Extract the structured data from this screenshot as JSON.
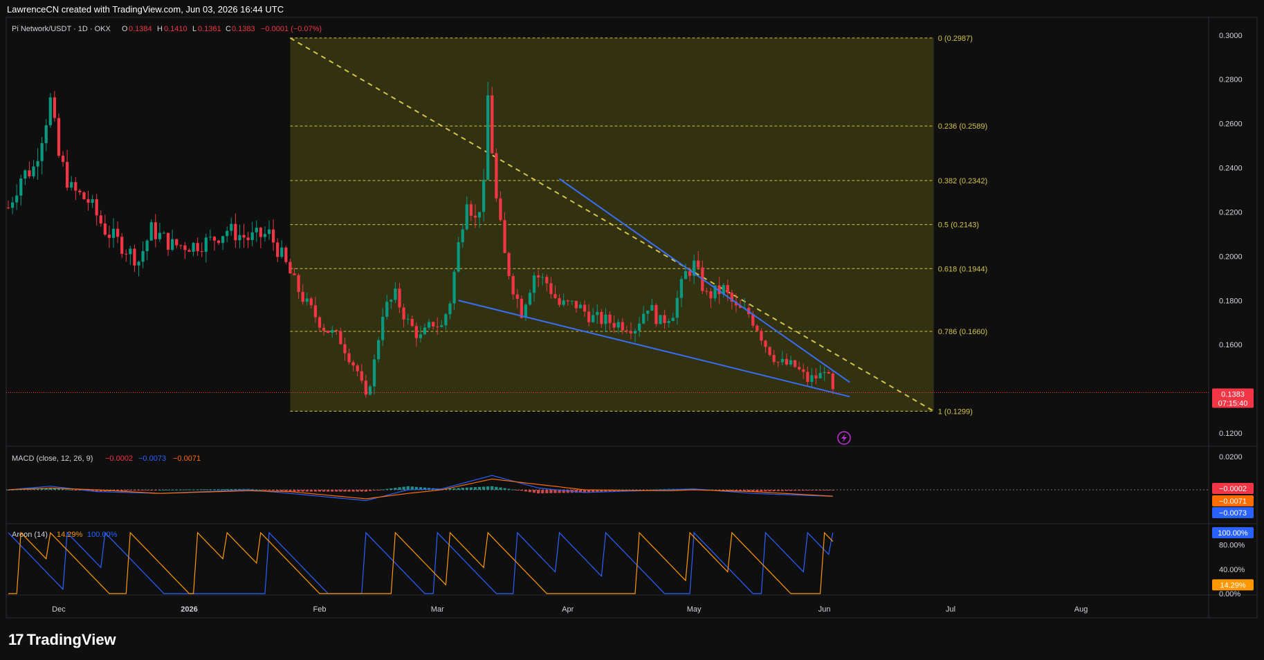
{
  "header": {
    "caption": "LawrenceCN created with TradingView.com, Jun 03, 2026 16:44 UTC"
  },
  "symbol_bar": {
    "symbol": "Pi Network/USDT · 1D · OKX",
    "o_label": "O",
    "o_value": "0.1384",
    "h_label": "H",
    "h_value": "0.1410",
    "l_label": "L",
    "l_value": "0.1361",
    "c_label": "C",
    "c_value": "0.1383",
    "change": "−0.0001 (−0.07%)"
  },
  "brand": {
    "name": "TradingView",
    "logo": "17"
  },
  "colors": {
    "bg": "#0f0f0f",
    "pane_border": "#2a2e39",
    "up": "#089981",
    "down": "#f23645",
    "fib_zone": "#3b3a12",
    "fib_line": "#d4c44a",
    "trendline": "#3a6ff2",
    "macd_line": "#2962ff",
    "signal_line": "#ff6d00",
    "hist_pos": "#26a69a",
    "hist_neg": "#ef5350",
    "aroon_up": "#ff9800",
    "aroon_down": "#2962ff",
    "price_label": "#f23645"
  },
  "indicators": {
    "macd": {
      "title": "MACD (close, 12, 26, 9)",
      "v1": "−0.0002",
      "v2": "−0.0073",
      "v3": "−0.0071",
      "axis": [
        "0.0200"
      ],
      "labels": [
        "−0.0002",
        "−0.0071",
        "−0.0073"
      ]
    },
    "aroon": {
      "title": "Aroon (14)",
      "v1": "14.29%",
      "v2": "100.00%",
      "axis": [
        "80.00%",
        "40.00%",
        "0.00%"
      ],
      "labels": [
        "100.00%",
        "14.29%"
      ]
    }
  },
  "last_price": {
    "value": "0.1383",
    "countdown": "07:15:40"
  },
  "chart_data": {
    "type": "candlestick",
    "title": "Pi Network/USDT · 1D · OKX",
    "ylim": [
      0.115,
      0.3065
    ],
    "y_ticks": [
      0.3,
      0.28,
      0.26,
      0.24,
      0.22,
      0.2,
      0.18,
      0.16,
      0.12
    ],
    "y_tick_labels": [
      "0.3000",
      "0.2800",
      "0.2600",
      "0.2400",
      "0.2200",
      "0.2000",
      "0.1800",
      "0.1600",
      "0.1200"
    ],
    "x_tick_labels": [
      "Dec",
      "2026",
      "Feb",
      "Mar",
      "Apr",
      "May",
      "Jun",
      "Jul",
      "Aug"
    ],
    "x_tick_dates": [
      "2025-12-01",
      "2026-01-01",
      "2026-02-01",
      "2026-03-01",
      "2026-04-01",
      "2026-05-01",
      "2026-06-01",
      "2026-07-01",
      "2026-08-01"
    ],
    "date_range": [
      "2025-11-19",
      "2026-08-31"
    ],
    "fib_levels": [
      {
        "ratio": "0",
        "price": 0.2987,
        "label": "0 (0.2987)"
      },
      {
        "ratio": "0.236",
        "price": 0.2589,
        "label": "0.236 (0.2589)"
      },
      {
        "ratio": "0.382",
        "price": 0.2342,
        "label": "0.382 (0.2342)"
      },
      {
        "ratio": "0.5",
        "price": 0.2143,
        "label": "0.5 (0.2143)"
      },
      {
        "ratio": "0.618",
        "price": 0.1944,
        "label": "0.618 (0.1944)"
      },
      {
        "ratio": "0.786",
        "price": 0.166,
        "label": "0.786 (0.1660)"
      },
      {
        "ratio": "1",
        "price": 0.1299,
        "label": "1 (0.1299)"
      }
    ],
    "fib_date_range": [
      "2026-01-25",
      "2026-06-27"
    ],
    "fib_diagonal": {
      "from": [
        "2026-01-25",
        0.2987
      ],
      "to": [
        "2026-06-27",
        0.1299
      ]
    },
    "wedge_upper": {
      "from": [
        "2026-03-30",
        0.235
      ],
      "to": [
        "2026-06-07",
        0.143
      ]
    },
    "wedge_lower": {
      "from": [
        "2026-03-06",
        0.18
      ],
      "to": [
        "2026-06-07",
        0.1365
      ]
    },
    "anchors": [
      [
        "2025-11-19",
        0.222
      ],
      [
        "2025-11-22",
        0.236
      ],
      [
        "2025-11-25",
        0.24
      ],
      [
        "2025-11-29",
        0.27
      ],
      [
        "2025-12-01",
        0.245
      ],
      [
        "2025-12-04",
        0.23
      ],
      [
        "2025-12-08",
        0.225
      ],
      [
        "2025-12-12",
        0.212
      ],
      [
        "2025-12-16",
        0.205
      ],
      [
        "2025-12-20",
        0.198
      ],
      [
        "2025-12-23",
        0.212
      ],
      [
        "2025-12-28",
        0.205
      ],
      [
        "2026-01-02",
        0.205
      ],
      [
        "2026-01-06",
        0.207
      ],
      [
        "2026-01-10",
        0.212
      ],
      [
        "2026-01-15",
        0.208
      ],
      [
        "2026-01-20",
        0.21
      ],
      [
        "2026-01-23",
        0.2
      ],
      [
        "2026-01-26",
        0.188
      ],
      [
        "2026-01-29",
        0.178
      ],
      [
        "2026-02-02",
        0.168
      ],
      [
        "2026-02-06",
        0.162
      ],
      [
        "2026-02-10",
        0.148
      ],
      [
        "2026-02-12",
        0.135
      ],
      [
        "2026-02-14",
        0.152
      ],
      [
        "2026-02-16",
        0.175
      ],
      [
        "2026-02-19",
        0.182
      ],
      [
        "2026-02-22",
        0.17
      ],
      [
        "2026-02-25",
        0.163
      ],
      [
        "2026-02-28",
        0.17
      ],
      [
        "2026-03-02",
        0.168
      ],
      [
        "2026-03-04",
        0.18
      ],
      [
        "2026-03-06",
        0.205
      ],
      [
        "2026-03-08",
        0.228
      ],
      [
        "2026-03-10",
        0.216
      ],
      [
        "2026-03-12",
        0.23
      ],
      [
        "2026-03-13",
        0.272
      ],
      [
        "2026-03-15",
        0.225
      ],
      [
        "2026-03-17",
        0.2
      ],
      [
        "2026-03-19",
        0.186
      ],
      [
        "2026-03-21",
        0.175
      ],
      [
        "2026-03-24",
        0.192
      ],
      [
        "2026-03-27",
        0.188
      ],
      [
        "2026-03-30",
        0.178
      ],
      [
        "2026-04-03",
        0.178
      ],
      [
        "2026-04-07",
        0.172
      ],
      [
        "2026-04-12",
        0.17
      ],
      [
        "2026-04-17",
        0.168
      ],
      [
        "2026-04-20",
        0.178
      ],
      [
        "2026-04-23",
        0.17
      ],
      [
        "2026-04-26",
        0.175
      ],
      [
        "2026-04-29",
        0.192
      ],
      [
        "2026-05-01",
        0.196
      ],
      [
        "2026-05-04",
        0.182
      ],
      [
        "2026-05-08",
        0.185
      ],
      [
        "2026-05-11",
        0.176
      ],
      [
        "2026-05-14",
        0.174
      ],
      [
        "2026-05-16",
        0.168
      ],
      [
        "2026-05-18",
        0.16
      ],
      [
        "2026-05-21",
        0.152
      ],
      [
        "2026-05-25",
        0.15
      ],
      [
        "2026-05-28",
        0.144
      ],
      [
        "2026-05-31",
        0.146
      ],
      [
        "2026-06-01",
        0.15
      ],
      [
        "2026-06-03",
        0.1383
      ]
    ],
    "series_macd": [
      [
        "2025-11-19",
        0.0
      ],
      [
        "2025-11-29",
        0.004
      ],
      [
        "2025-12-10",
        -0.002
      ],
      [
        "2025-12-25",
        -0.004
      ],
      [
        "2026-01-15",
        0.0
      ],
      [
        "2026-01-25",
        -0.004
      ],
      [
        "2026-02-12",
        -0.012
      ],
      [
        "2026-02-22",
        0.0
      ],
      [
        "2026-03-02",
        0.001
      ],
      [
        "2026-03-14",
        0.016
      ],
      [
        "2026-03-25",
        0.002
      ],
      [
        "2026-04-05",
        -0.003
      ],
      [
        "2026-04-25",
        0.0
      ],
      [
        "2026-05-01",
        0.001
      ],
      [
        "2026-05-15",
        -0.004
      ],
      [
        "2026-06-03",
        -0.0073
      ]
    ],
    "series_signal": [
      [
        "2025-11-19",
        0.0
      ],
      [
        "2025-11-29",
        0.002
      ],
      [
        "2025-12-10",
        0.0
      ],
      [
        "2025-12-25",
        -0.004
      ],
      [
        "2026-01-15",
        -0.001
      ],
      [
        "2026-01-25",
        -0.002
      ],
      [
        "2026-02-12",
        -0.01
      ],
      [
        "2026-02-22",
        -0.004
      ],
      [
        "2026-03-02",
        0.0
      ],
      [
        "2026-03-14",
        0.012
      ],
      [
        "2026-03-25",
        0.006
      ],
      [
        "2026-04-05",
        0.0
      ],
      [
        "2026-04-25",
        -0.001
      ],
      [
        "2026-05-01",
        0.0
      ],
      [
        "2026-05-15",
        -0.002
      ],
      [
        "2026-06-03",
        -0.0071
      ]
    ],
    "aroon_pivots_up": [
      "2025-11-22",
      "2025-11-29",
      "2025-12-18",
      "2026-01-03",
      "2026-01-10",
      "2026-01-18",
      "2026-02-19",
      "2026-03-04",
      "2026-03-13",
      "2026-04-18",
      "2026-04-30",
      "2026-05-10",
      "2026-06-01"
    ],
    "aroon_pivots_down": [
      "2025-11-19",
      "2025-12-03",
      "2025-12-12",
      "2026-01-20",
      "2026-02-12",
      "2026-03-01",
      "2026-03-20",
      "2026-03-30",
      "2026-04-10",
      "2026-05-01",
      "2026-05-18",
      "2026-05-28",
      "2026-06-03"
    ]
  }
}
